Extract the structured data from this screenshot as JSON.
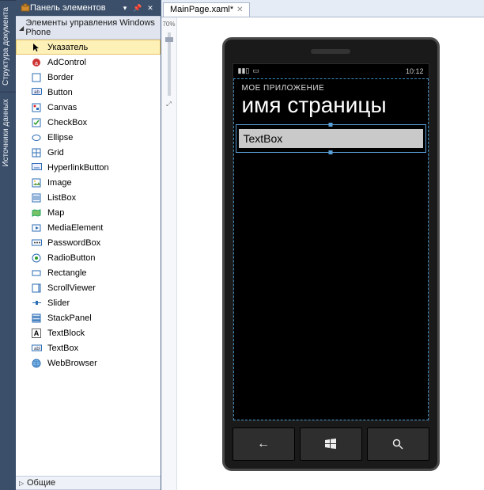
{
  "vertical_tabs": [
    "Структура документа",
    "Источники данных"
  ],
  "toolbox": {
    "title": "Панель элементов",
    "group_phone": "Элементы управления Windows Phone",
    "group_common": "Общие",
    "items": [
      "Указатель",
      "AdControl",
      "Border",
      "Button",
      "Canvas",
      "CheckBox",
      "Ellipse",
      "Grid",
      "HyperlinkButton",
      "Image",
      "ListBox",
      "Map",
      "MediaElement",
      "PasswordBox",
      "RadioButton",
      "Rectangle",
      "ScrollViewer",
      "Slider",
      "StackPanel",
      "TextBlock",
      "TextBox",
      "WebBrowser"
    ],
    "selected_index": 0
  },
  "editor": {
    "file_tab": "MainPage.xaml*",
    "zoom_label": "70%"
  },
  "phone": {
    "time": "10:12",
    "app_name": "МОЕ ПРИЛОЖЕНИЕ",
    "page_name": "имя страницы",
    "textbox_value": "TextBox"
  }
}
